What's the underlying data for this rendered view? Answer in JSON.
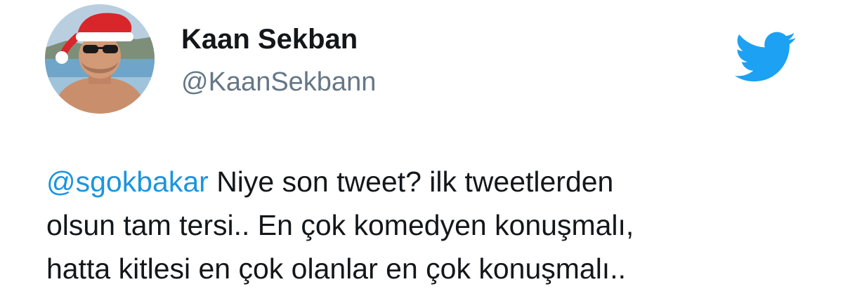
{
  "user": {
    "display_name": "Kaan Sekban",
    "handle": "@KaanSekbann",
    "avatar_alt": "profile-photo"
  },
  "brand": {
    "icon": "twitter-bird-icon",
    "color": "#1da1f2"
  },
  "tweet": {
    "mention": "@sgokbakar",
    "line1_rest": " Niye son tweet? ilk tweetlerden",
    "line2": "olsun tam tersi.. En çok komedyen konuşmalı,",
    "line3": "hatta kitlesi en çok olanlar en çok konuşmalı.."
  },
  "colors": {
    "text": "#14171a",
    "secondary": "#657786",
    "link": "#1b95e0"
  }
}
